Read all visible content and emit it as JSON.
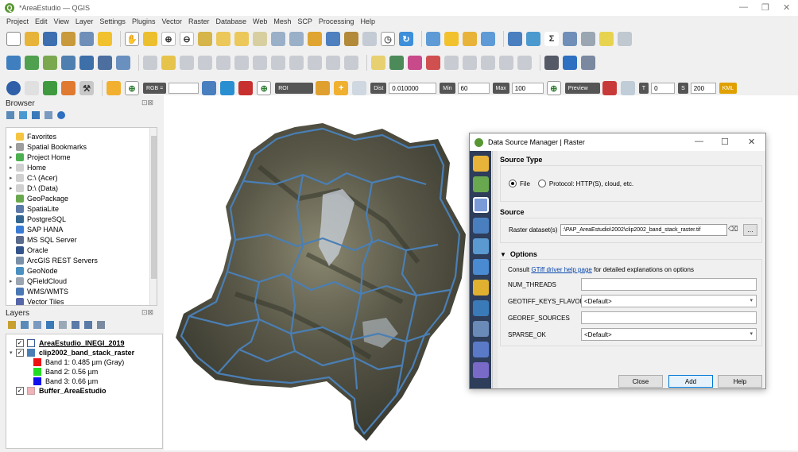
{
  "window": {
    "title": "*AreaEstudio — QGIS",
    "logo_letter": "Q",
    "min_glyph": "—",
    "max_glyph": "❐",
    "close_glyph": "✕"
  },
  "menu": [
    "Project",
    "Edit",
    "View",
    "Layer",
    "Settings",
    "Plugins",
    "Vector",
    "Raster",
    "Database",
    "Web",
    "Mesh",
    "SCP",
    "Processing",
    "Help"
  ],
  "scp_toolbar": {
    "rgb_label": "RGB =",
    "roi_label": "ROI",
    "dist_label": "Dist",
    "dist_value": "0.010000",
    "min_label": "Min",
    "min_value": "60",
    "max_label": "Max",
    "max_value": "100",
    "preview_label": "Preview",
    "t_label": "T",
    "t_value": "0",
    "s_label": "S",
    "s_value": "200",
    "kml_label": "KML"
  },
  "browser": {
    "title": "Browser",
    "items": [
      {
        "label": "Favorites",
        "icon": "star-icon",
        "color": "#f5c542",
        "expand": ""
      },
      {
        "label": "Spatial Bookmarks",
        "icon": "bookmark-icon",
        "color": "#9e9e9e",
        "expand": "▸"
      },
      {
        "label": "Project Home",
        "icon": "home-folder-icon",
        "color": "#4caf50",
        "expand": "▸"
      },
      {
        "label": "Home",
        "icon": "folder-icon",
        "color": "#d0d0d0",
        "expand": "▸"
      },
      {
        "label": "C:\\ (Acer)",
        "icon": "drive-icon",
        "color": "#d0d0d0",
        "expand": "▸"
      },
      {
        "label": "D:\\ (Data)",
        "icon": "drive-icon",
        "color": "#d0d0d0",
        "expand": "▸"
      },
      {
        "label": "GeoPackage",
        "icon": "geopackage-icon",
        "color": "#6aa84f",
        "expand": ""
      },
      {
        "label": "SpatiaLite",
        "icon": "feather-icon",
        "color": "#5b7aa8",
        "expand": ""
      },
      {
        "label": "PostgreSQL",
        "icon": "elephant-icon",
        "color": "#336791",
        "expand": ""
      },
      {
        "label": "SAP HANA",
        "icon": "database-icon",
        "color": "#3a7bd5",
        "expand": ""
      },
      {
        "label": "MS SQL Server",
        "icon": "server-icon",
        "color": "#5a6b8c",
        "expand": ""
      },
      {
        "label": "Oracle",
        "icon": "oracle-icon",
        "color": "#34558b",
        "expand": ""
      },
      {
        "label": "ArcGIS REST Servers",
        "icon": "globe-icon",
        "color": "#7a8fa8",
        "expand": ""
      },
      {
        "label": "GeoNode",
        "icon": "geonode-icon",
        "color": "#4a90c2",
        "expand": ""
      },
      {
        "label": "QFieldCloud",
        "icon": "cloud-icon",
        "color": "#9aa5b1",
        "expand": "▸"
      },
      {
        "label": "WMS/WMTS",
        "icon": "wms-icon",
        "color": "#4a78b5",
        "expand": ""
      },
      {
        "label": "Vector Tiles",
        "icon": "grid-icon",
        "color": "#5566aa",
        "expand": ""
      }
    ]
  },
  "layers": {
    "title": "Layers",
    "items": [
      {
        "label": "AreaEstudio_INEGI_2019",
        "kind": "layer",
        "checked": "✓",
        "bold": true,
        "underline": true,
        "expand": "",
        "swatch": "",
        "color": "#ffffff",
        "border": "#3a5b9a"
      },
      {
        "label": "clip2002_band_stack_raster",
        "kind": "layer",
        "checked": "✓",
        "bold": true,
        "underline": false,
        "expand": "▾",
        "swatch": "",
        "color": "#4a7fb5",
        "border": "#4a7fb5"
      },
      {
        "label": "Band 1: 0.485 µm (Gray)",
        "kind": "band",
        "checked": "",
        "bold": false,
        "underline": false,
        "expand": "",
        "swatch": "red",
        "color": "#ee1111",
        "border": "#ee1111"
      },
      {
        "label": "Band 2: 0.56 µm",
        "kind": "band",
        "checked": "",
        "bold": false,
        "underline": false,
        "expand": "",
        "swatch": "green",
        "color": "#22dd22",
        "border": "#22dd22"
      },
      {
        "label": "Band 3: 0.66 µm",
        "kind": "band",
        "checked": "",
        "bold": false,
        "underline": false,
        "expand": "",
        "swatch": "blue",
        "color": "#1111ee",
        "border": "#1111ee"
      },
      {
        "label": "Buffer_AreaEstudio",
        "kind": "layer",
        "checked": "✓",
        "bold": true,
        "underline": false,
        "expand": "",
        "swatch": "",
        "color": "#eeb4b8",
        "border": "#c9a0a4"
      }
    ]
  },
  "dialog": {
    "title": "Data Source Manager | Raster",
    "source_type_heading": "Source Type",
    "file_label": "File",
    "protocol_label": "Protocol: HTTP(S), cloud, etc.",
    "source_heading": "Source",
    "raster_dataset_label": "Raster dataset(s)",
    "raster_dataset_value": ":\\PAP_AreaEstudio\\2002\\clip2002_band_stack_raster.tif",
    "browse_label": "…",
    "options_heading": "Options",
    "consult_prefix": "Consult",
    "consult_link": "GTiff driver help page",
    "consult_suffix": "for detailed explanations on options",
    "options": [
      {
        "key": "NUM_THREADS",
        "value": "",
        "dropdown": false
      },
      {
        "key": "GEOTIFF_KEYS_FLAVOR",
        "value": "<Default>",
        "dropdown": true
      },
      {
        "key": "GEOREF_SOURCES",
        "value": "",
        "dropdown": false
      },
      {
        "key": "SPARSE_OK",
        "value": "<Default>",
        "dropdown": true
      }
    ],
    "close_label": "Close",
    "add_label": "Add",
    "help_label": "Help"
  },
  "colors": {
    "accent": "#589632",
    "dialog_sidebar": "#2d3d5a",
    "boundary_line": "#4a7fb5",
    "link": "#0645ad"
  }
}
